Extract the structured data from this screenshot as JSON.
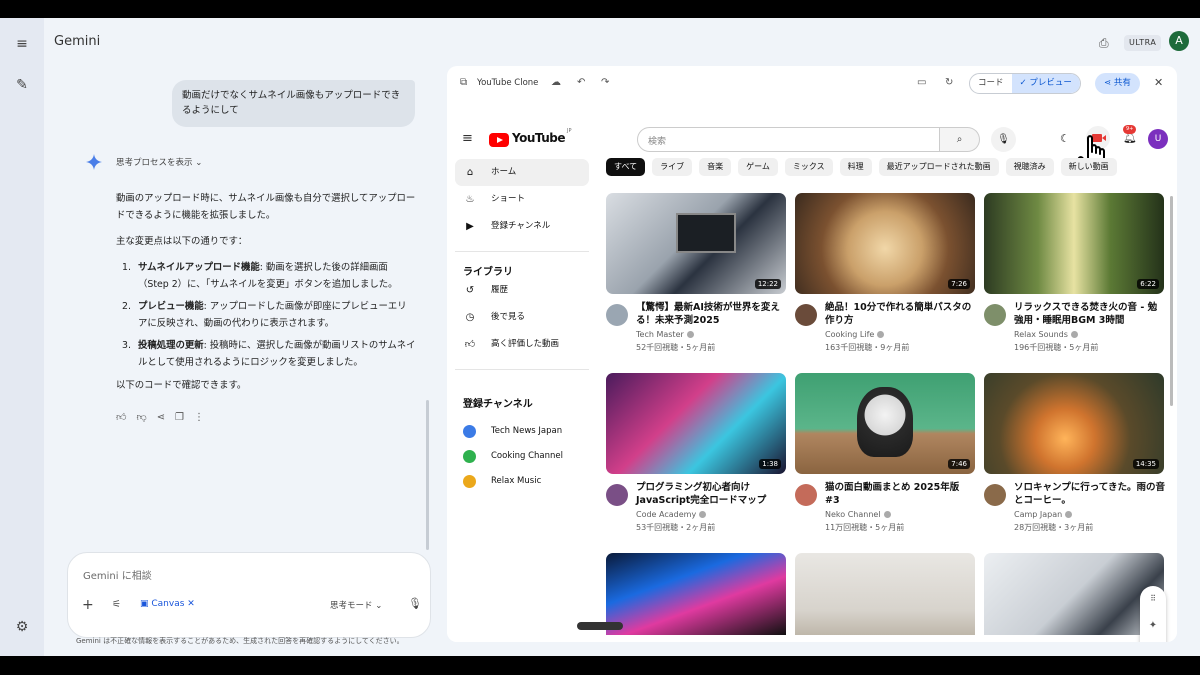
{
  "app": {
    "title": "Gemini",
    "plan": "ULTRA",
    "avatar": "A"
  },
  "chat": {
    "user_message": "動画だけでなくサムネイル画像もアップロードできるようにして",
    "thinking_label": "思考プロセスを表示",
    "intro": "動画のアップロード時に、サムネイル画像も自分で選択してアップロードできるように機能を拡張しました。",
    "changes_heading": "主な変更点は以下の通りです：",
    "changes": [
      {
        "num": "1.",
        "bold": "サムネイルアップロード機能",
        "text": ": 動画を選択した後の詳細画面（Step 2）に、「サムネイルを変更」ボタンを追加しました。"
      },
      {
        "num": "2.",
        "bold": "プレビュー機能",
        "text": ": アップロードした画像が即座にプレビューエリアに反映され、動画の代わりに表示されます。"
      },
      {
        "num": "3.",
        "bold": "投稿処理の更新",
        "text": ": 投稿時に、選択した画像が動画リストのサムネイルとして使用されるようにロジックを変更しました。"
      }
    ],
    "outro": "以下のコードで確認できます。"
  },
  "composer": {
    "placeholder": "Gemini に相談",
    "canvas_label": "Canvas",
    "mode_label": "思考モード",
    "disclaimer": "Gemini は不正確な情報を表示することがあるため、生成された回答を再確認するようにしてください。"
  },
  "canvas_panel": {
    "title": "YouTube Clone",
    "code_tab": "コード",
    "preview_tab": "プレビュー",
    "share_label": "共有"
  },
  "youtube": {
    "logo_text": "YouTube",
    "logo_sup": "JP",
    "search_placeholder": "検索",
    "notif_count": "9+",
    "user_initial": "U",
    "sidebar_main": [
      {
        "label": "ホーム",
        "icon": "home-icon"
      },
      {
        "label": "ショート",
        "icon": "shorts-icon"
      },
      {
        "label": "登録チャンネル",
        "icon": "subscriptions-icon"
      }
    ],
    "library_heading": "ライブラリ",
    "sidebar_library": [
      {
        "label": "履歴",
        "icon": "history-icon"
      },
      {
        "label": "後で見る",
        "icon": "clock-icon"
      },
      {
        "label": "高く評価した動画",
        "icon": "thumbs-up-icon"
      }
    ],
    "subs_heading": "登録チャンネル",
    "subscriptions": [
      {
        "label": "Tech News Japan",
        "color": "#3b7be6"
      },
      {
        "label": "Cooking Channel",
        "color": "#2fb14e"
      },
      {
        "label": "Relax Music",
        "color": "#eba81b"
      }
    ],
    "chips": [
      "すべて",
      "ライブ",
      "音楽",
      "ゲーム",
      "ミックス",
      "料理",
      "最近アップロードされた動画",
      "視聴済み",
      "新しい動画"
    ],
    "videos": [
      {
        "title": "【驚愕】最新AI技術が世界を変える！未来予測2025",
        "channel": "Tech Master",
        "meta": "52千回視聴・5ヶ月前",
        "duration": "12:22"
      },
      {
        "title": "絶品！10分で作れる簡単パスタの作り方",
        "channel": "Cooking Life",
        "meta": "163千回視聴・9ヶ月前",
        "duration": "7:26"
      },
      {
        "title": "リラックスできる焚き火の音 - 勉強用・睡眠用BGM 3時間",
        "channel": "Relax Sounds",
        "meta": "196千回視聴・5ヶ月前",
        "duration": "6:22"
      },
      {
        "title": "プログラミング初心者向け JavaScript完全ロードマップ",
        "channel": "Code Academy",
        "meta": "53千回視聴・2ヶ月前",
        "duration": "1:38"
      },
      {
        "title": "猫の面白動画まとめ 2025年版 #3",
        "channel": "Neko Channel",
        "meta": "11万回視聴・5ヶ月前",
        "duration": "7:46"
      },
      {
        "title": "ソロキャンプに行ってきた。雨の音とコーヒー。",
        "channel": "Camp Japan",
        "meta": "28万回視聴・3ヶ月前",
        "duration": "14:35"
      }
    ]
  }
}
